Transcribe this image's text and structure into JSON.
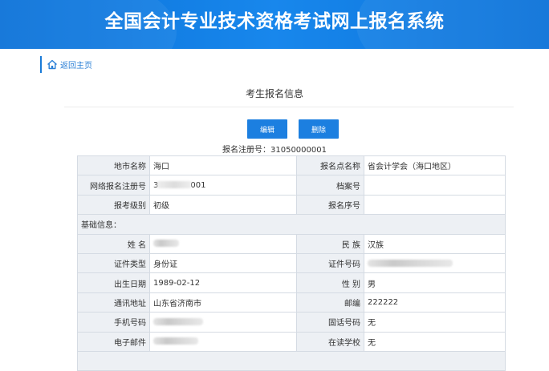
{
  "header": {
    "title": "全国会计专业技术资格考试网上报名系统"
  },
  "nav": {
    "back_home": "返回主页",
    "home_icon": "home-icon"
  },
  "page": {
    "title": "考生报名信息"
  },
  "actions": {
    "edit": "编辑",
    "delete": "删除"
  },
  "registration": {
    "line": "报名注册号：31050000001"
  },
  "table": {
    "city_label": "地市名称",
    "city_value": "海口",
    "site_label": "报名点名称",
    "site_value": "省会计学会（海口地区）",
    "online_reg_label": "网络报名注册号",
    "online_reg_prefix": "3",
    "online_reg_suffix": "001",
    "archive_label": "档案号",
    "archive_value": "",
    "level_label": "报考级别",
    "level_value": "初级",
    "serial_label": "报名序号",
    "serial_value": "",
    "section_basic": "基础信息：",
    "name_label": "姓 名",
    "ethnic_label": "民 族",
    "ethnic_value": "汉族",
    "idtype_label": "证件类型",
    "idtype_value": "身份证",
    "idno_label": "证件号码",
    "birth_label": "出生日期",
    "birth_value": "1989-02-12",
    "gender_label": "性 别",
    "gender_value": "男",
    "address_label": "通讯地址",
    "address_value": "山东省济南市",
    "postcode_label": "邮编",
    "postcode_value": "222222",
    "mobile_label": "手机号码",
    "phone_label": "固话号码",
    "phone_value": "无",
    "email_label": "电子邮件",
    "school_label": "在读学校",
    "school_value": "无"
  }
}
